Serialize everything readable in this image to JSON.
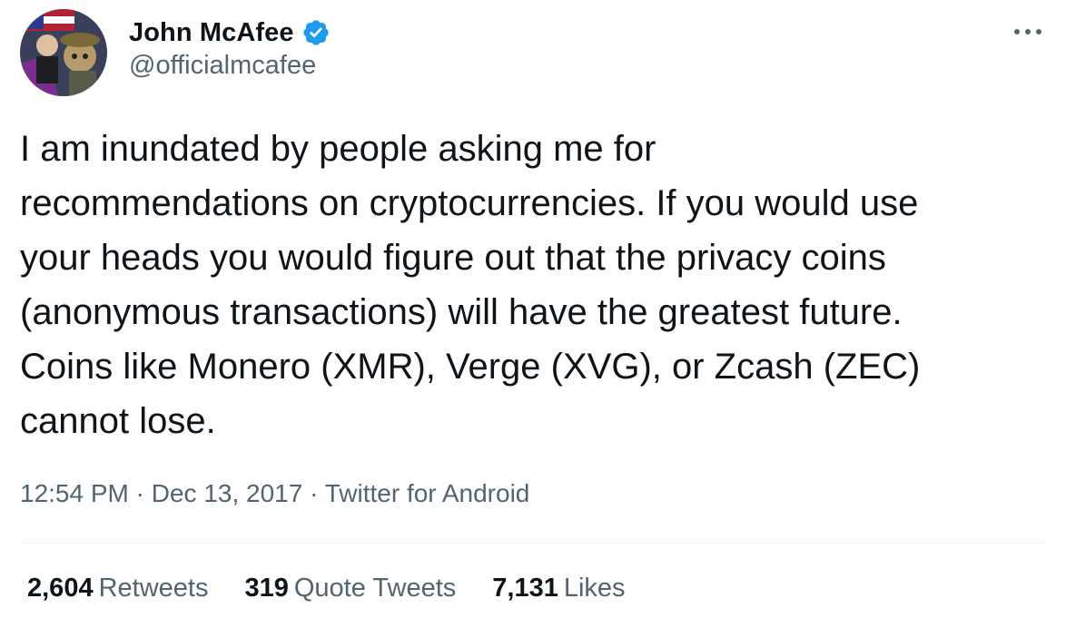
{
  "author": {
    "display_name": "John McAfee",
    "handle": "@officialmcafee",
    "verified": true
  },
  "tweet": {
    "text": "I am inundated by people asking me for\nrecommendations on cryptocurrencies. If you would use\nyour heads you would figure out that the privacy coins\n(anonymous transactions) will have the greatest future.\nCoins like Monero (XMR), Verge (XVG), or Zcash (ZEC)\ncannot lose.",
    "time": "12:54 PM",
    "date": "Dec 13, 2017",
    "source": "Twitter for Android",
    "separator": "·"
  },
  "stats": {
    "retweets_count": "2,604",
    "retweets_label": "Retweets",
    "quotes_count": "319",
    "quotes_label": "Quote Tweets",
    "likes_count": "7,131",
    "likes_label": "Likes"
  },
  "icons": {
    "verified": "verified-badge-icon",
    "more": "more-options-icon"
  },
  "colors": {
    "text_primary": "#0f1419",
    "text_secondary": "#536471",
    "verified_blue": "#1d9bf0",
    "divider": "#eff3f4"
  }
}
